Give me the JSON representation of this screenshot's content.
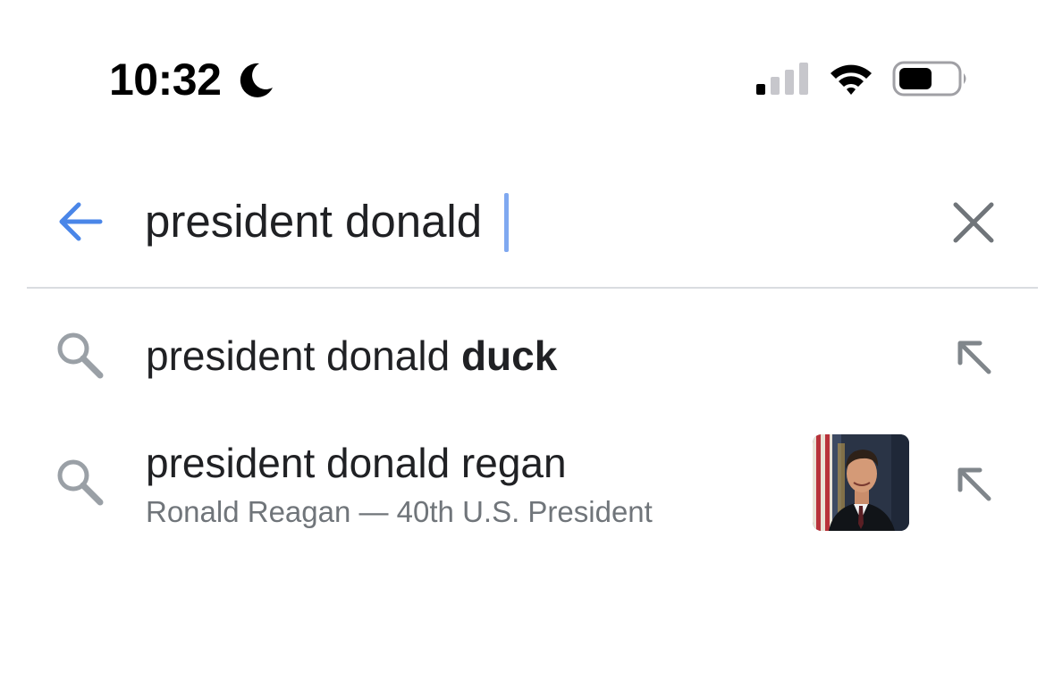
{
  "status_bar": {
    "time": "10:32",
    "focus_icon": "moon-icon",
    "signal_icon": "cellular-signal-icon",
    "wifi_icon": "wifi-icon",
    "battery_icon": "battery-icon"
  },
  "search": {
    "query": "president donald",
    "back_icon": "back-arrow-icon",
    "clear_icon": "close-icon"
  },
  "suggestions": [
    {
      "prefix": "president donald ",
      "completion": "duck",
      "icon": "search-icon",
      "action_icon": "fill-query-arrow-icon"
    },
    {
      "text": "president donald regan",
      "subtext": "Ronald Reagan — 40th U.S. President",
      "icon": "search-icon",
      "thumbnail": "portrait-thumbnail",
      "action_icon": "fill-query-arrow-icon"
    }
  ],
  "colors": {
    "accent": "#4a86e8",
    "icon_gray": "#80868b",
    "text": "#202124",
    "subtext": "#70757a",
    "divider": "#dadce0"
  }
}
